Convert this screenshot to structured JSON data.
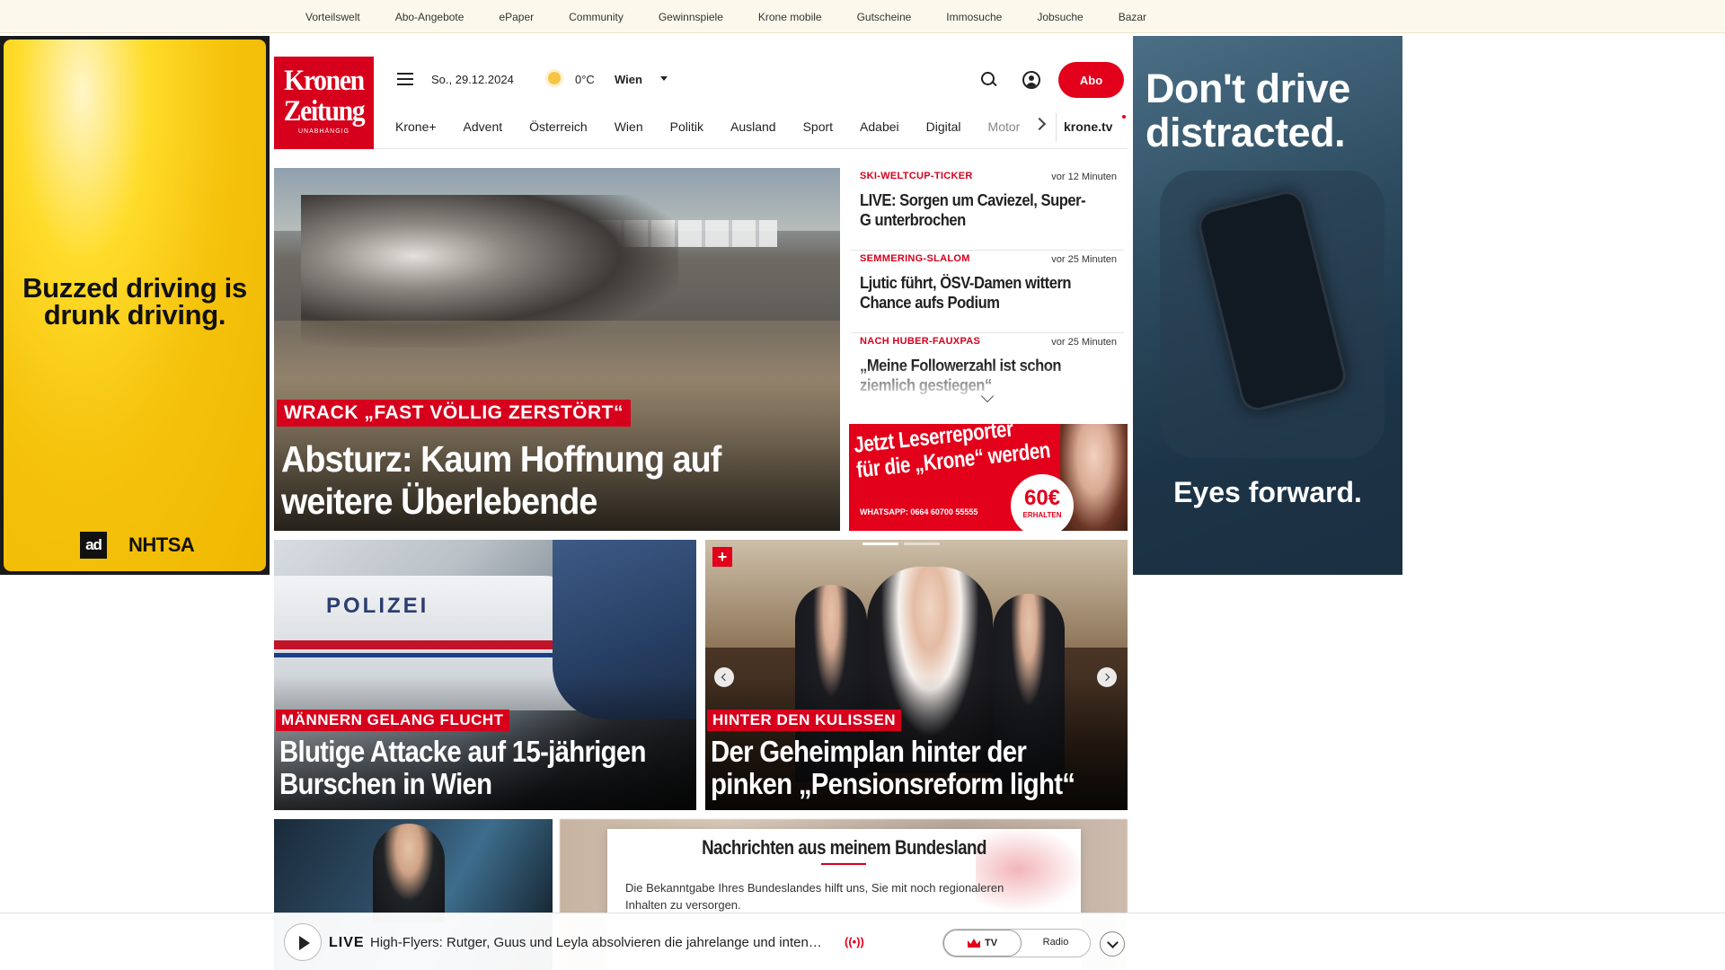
{
  "topbar": {
    "links": [
      "Vorteilswelt",
      "Abo-Angebote",
      "ePaper",
      "Community",
      "Gewinnspiele",
      "Krone mobile",
      "Gutscheine",
      "Immosuche",
      "Jobsuche",
      "Bazar"
    ]
  },
  "ad_left": {
    "headline": "Buzzed driving is drunk driving.",
    "logo1": "ad",
    "logo2": "NHTSA",
    "bg_color": "#f5c20c"
  },
  "ad_right": {
    "headline": "Don't drive distracted.",
    "footer": "Eyes forward."
  },
  "header": {
    "logo_line1": "Kronen",
    "logo_line2": "Zeitung",
    "logo_tagline": "UNABHÄNGIG",
    "brand_color": "#d6001c",
    "date": "So., 29.12.2024",
    "temperature": "0°C",
    "city": "Wien",
    "abo_label": "Abo"
  },
  "nav": {
    "items": [
      "Krone+",
      "Advent",
      "Österreich",
      "Wien",
      "Politik",
      "Ausland",
      "Sport",
      "Adabei",
      "Digital",
      "Motor"
    ],
    "tv_label": "krone.tv"
  },
  "hero": {
    "kicker": "WRACK „FAST VÖLLIG ZERSTÖRT“",
    "title": "Absturz: Kaum Hoffnung auf weitere Überlebende"
  },
  "ticker": [
    {
      "kicker": "SKI-WELTCUP-TICKER",
      "time": "vor 12 Minuten",
      "title": "LIVE: Sorgen um Caviezel, Super-G unterbrochen"
    },
    {
      "kicker": "SEMMERING-SLALOM",
      "time": "vor 25 Minuten",
      "title": "Ljutic führt, ÖSV-Damen wittern Chance aufs Podium"
    },
    {
      "kicker": "NACH HUBER-FAUXPAS",
      "time": "vor 25 Minuten",
      "title": "„Meine Followerzahl ist schon ziemlich gestiegen“"
    }
  ],
  "leserreporter_ad": {
    "line1": "Jetzt Leserreporter",
    "line2": "für die „Krone“ werden",
    "whatsapp": "WHATSAPP: 0664 60700 55555",
    "amount": "60€",
    "amount_sub": "ERHALTEN"
  },
  "cards": [
    {
      "kicker": "MÄNNERN GELANG FLUCHT",
      "title": "Blutige Attacke auf 15-jährigen Burschen in Wien",
      "image_text": "POLIZEI"
    },
    {
      "kicker": "HINTER DEN KULISSEN",
      "title": "Der Geheimplan hinter der pinken „Pensionsreform light“",
      "plus": "+"
    }
  ],
  "bundesland_modal": {
    "title": "Nachrichten aus meinem Bundesland",
    "text": "Die Bekanntgabe Ihres Bundeslandes hilft uns, Sie mit noch regionaleren Inhalten zu versorgen."
  },
  "player": {
    "live_label": "LIVE",
    "title": "High-Flyers: Rutger, Guus und Leyla absolvieren die jahrelange und inten…",
    "tv_label": "TV",
    "radio_label": "Radio"
  }
}
